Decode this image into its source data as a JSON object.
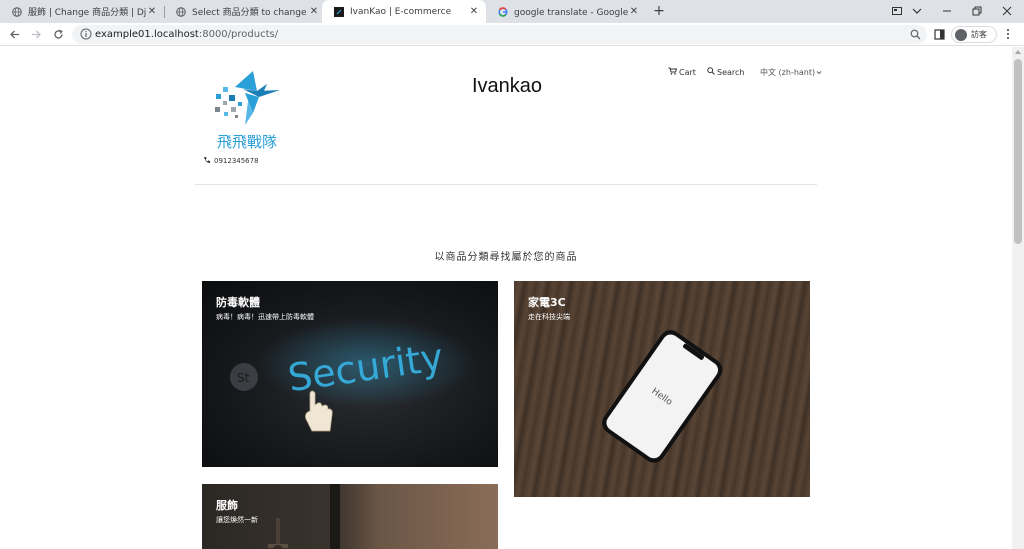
{
  "browser": {
    "tabs": [
      {
        "title": "服飾 | Change 商品分類 | Django",
        "icon": "globe-icon",
        "active": false
      },
      {
        "title": "Select 商品分類 to change | Djang",
        "icon": "globe-icon",
        "active": false
      },
      {
        "title": "IvanKao | E-commerce",
        "icon": "site-favicon",
        "active": true
      },
      {
        "title": "google translate - Google 搜尋",
        "icon": "google-icon",
        "active": false
      }
    ],
    "close_glyph": "✕",
    "newtab_glyph": "+",
    "url_host": "example01.localhost",
    "url_rest": ":8000/products/",
    "profile_label": "訪客"
  },
  "header": {
    "logo_text": "飛飛戰隊",
    "phone": "0912345678",
    "site_title": "Ivankao",
    "nav": {
      "cart": "Cart",
      "search": "Search",
      "language": "中文 (zh-hant)"
    }
  },
  "main": {
    "section_heading": "以商品分類尋找屬於您的商品",
    "categories": [
      {
        "title": "防毒軟體",
        "subtitle": "病毒！病毒！迅速帶上防毒軟體",
        "image_text": "Security"
      },
      {
        "title": "家電3C",
        "subtitle": "走在科技尖端",
        "image_text": "Hello"
      },
      {
        "title": "服飾",
        "subtitle": "讓您煥然一新"
      }
    ]
  },
  "colors": {
    "logo_blue": "#2a9fd8",
    "security_glow": "#37b4e6"
  }
}
